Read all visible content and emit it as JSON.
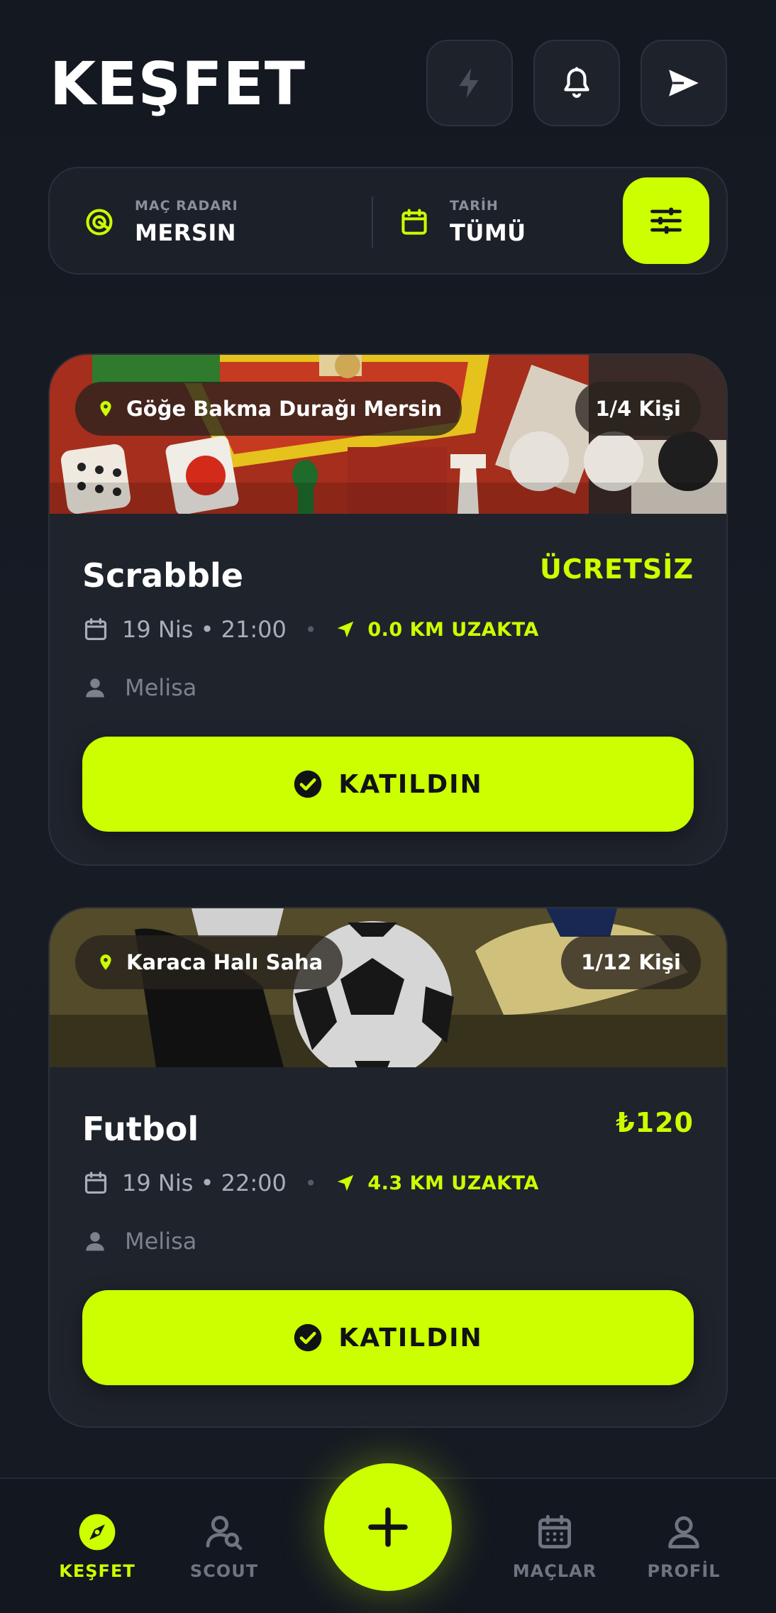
{
  "header": {
    "title": "KEŞFET",
    "buttons": [
      "bolt-icon",
      "bell-icon",
      "send-icon"
    ]
  },
  "filter": {
    "location_label": "MAÇ RADARI",
    "location_value": "MERSIN",
    "date_label": "TARİH",
    "date_value": "TÜMÜ",
    "filter_icon": "sliders-icon"
  },
  "events": [
    {
      "location": "Göğe Bakma Durağı Mersin",
      "capacity": "1/4 Kişi",
      "title": "Scrabble",
      "price": "ÜCRETSİZ",
      "datetime": "19 Nis • 21:00",
      "distance": "0.0 KM UZAKTA",
      "host": "Melisa",
      "action": "KATILDIN"
    },
    {
      "location": "Karaca Halı Saha",
      "capacity": "1/12 Kişi",
      "title": "Futbol",
      "price": "₺120",
      "datetime": "19 Nis • 22:00",
      "distance": "4.3 KM UZAKTA",
      "host": "Melisa",
      "action": "KATILDIN"
    }
  ],
  "separator": "•",
  "nav": {
    "items": [
      {
        "label": "KEŞFET",
        "icon": "compass-icon",
        "active": true
      },
      {
        "label": "SCOUT",
        "icon": "user-search-icon",
        "active": false
      },
      {
        "label": "MAÇLAR",
        "icon": "calendar-icon",
        "active": false
      },
      {
        "label": "PROFİL",
        "icon": "user-icon",
        "active": false
      }
    ],
    "fab_icon": "plus-icon"
  },
  "colors": {
    "accent": "#ccff00",
    "background": "#161a22",
    "card": "#1f232c"
  }
}
